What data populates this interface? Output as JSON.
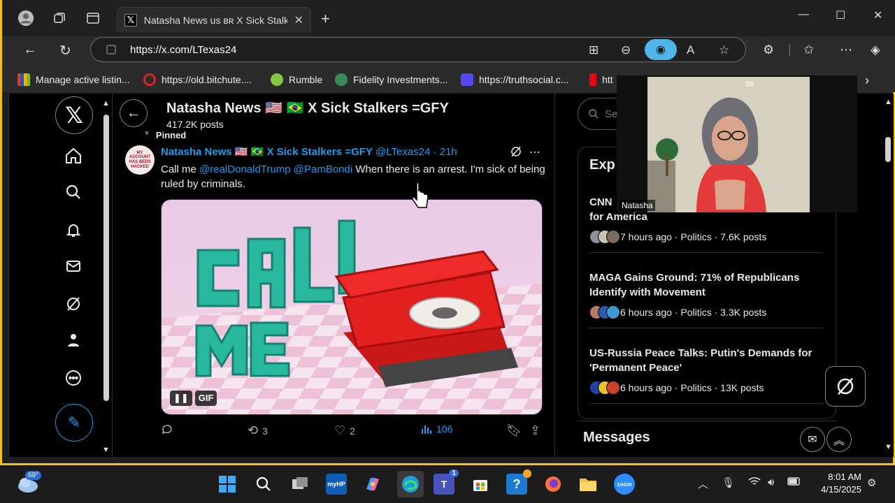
{
  "browser": {
    "tab_title": "Natasha News us ʙʀ X Sick Stalkers",
    "url": "https://x.com/LTexas24",
    "bookmarks": [
      {
        "label": "Manage active listin...",
        "color": "#f2c21b"
      },
      {
        "label": "https://old.bitchute....",
        "color": "#d8271d"
      },
      {
        "label": "Rumble",
        "color": "#85c742"
      },
      {
        "label": "Fidelity Investments...",
        "color": "#3a8a5a"
      },
      {
        "label": "https://truthsocial.c...",
        "color": "#5448ee"
      },
      {
        "label": "htt",
        "color": "#e50914"
      }
    ]
  },
  "profile": {
    "header_title": "Natasha News 🇺🇸 🇧🇷 X Sick Stalkers =GFY",
    "post_count": "417.2K posts"
  },
  "tweet": {
    "pinned_label": "Pinned",
    "avatar_text": "MY ACCOUNT HAS BEEN HACKED",
    "author_name": "Natasha News 🇺🇸 🇧🇷 X Sick Stalkers =GFY",
    "handle": "@LTexas24",
    "dot": "·",
    "time": "21h",
    "text_before": "Call me ",
    "mention1": "@realDonaldTrump",
    "space": " ",
    "mention2": "@PamBondi",
    "text_after": " When there is an arrest.  I'm sick of being ruled by criminals.",
    "media_words": [
      "CALL",
      "ME"
    ],
    "gif_pause": "❚❚",
    "gif_label": "GIF",
    "replies": "",
    "reposts": "3",
    "likes": "2",
    "views": "106"
  },
  "sidebar": {
    "search_placeholder": "Sea",
    "explore_title": "Exp",
    "trends": [
      {
        "title": "CNN … for America",
        "title_line1": "CNN",
        "title_line2": "for America",
        "meta": "7 hours ago · Politics · 7.6K posts"
      },
      {
        "title": "MAGA Gains Ground: 71% of Republicans Identify with Movement",
        "meta": "6 hours ago · Politics · 3.3K posts"
      },
      {
        "title": "US-Russia Peace Talks: Putin's Demands for 'Permanent Peace'",
        "meta": "6 hours ago · Politics · 13K posts"
      }
    ],
    "messages_title": "Messages"
  },
  "webcam": {
    "label": "Natasha"
  },
  "taskbar": {
    "weather_temp": "69°",
    "teams_badge": "1",
    "time": "8:01 AM",
    "date": "4/15/2025"
  }
}
